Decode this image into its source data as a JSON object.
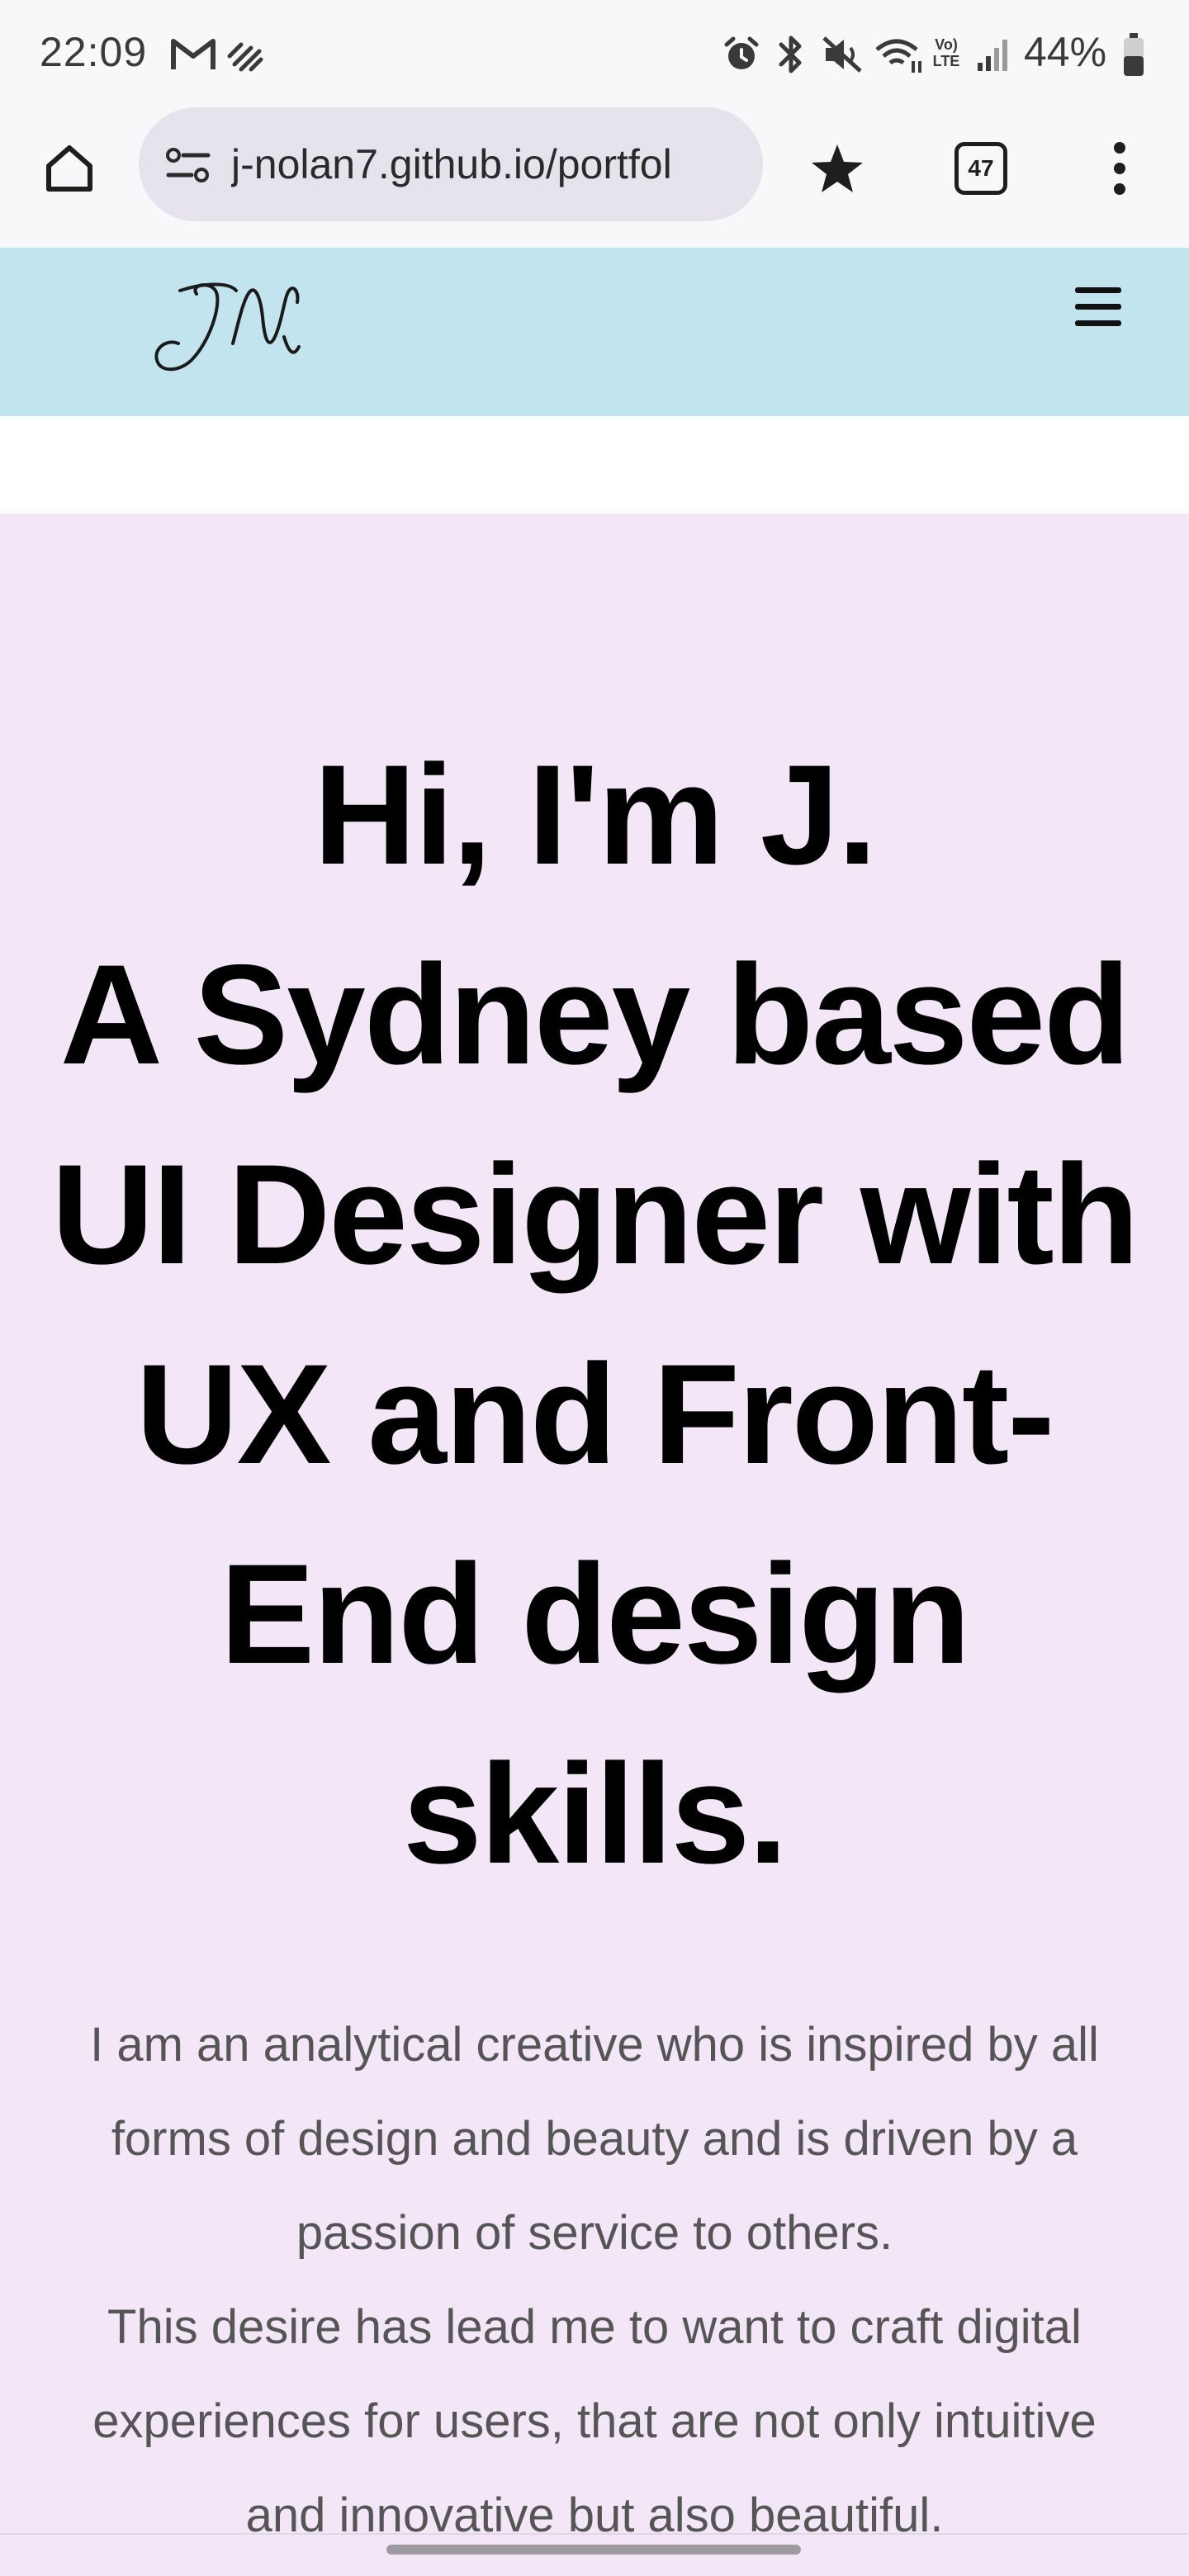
{
  "status_bar": {
    "time": "22:09",
    "battery": "44%",
    "icons": [
      "gmail-icon",
      "signal-activity-icon",
      "alarm-icon",
      "bluetooth-icon",
      "mute-icon",
      "wifi-icon",
      "volte-icon",
      "cell-signal-icon",
      "battery-icon"
    ],
    "volte_label": "Vo) LTE"
  },
  "browser": {
    "url": "j-nolan7.github.io/portfol",
    "tab_count": "47",
    "icons": [
      "home-icon",
      "site-settings-icon",
      "bookmark-star-icon",
      "tabs-icon",
      "more-vert-icon"
    ]
  },
  "site": {
    "logo_text": "JN",
    "header_color": "#c1e4ee",
    "hero_color": "#f3e7f7",
    "heading_lines": [
      "Hi, I'm J.",
      "A Sydney based",
      "UI Designer with",
      "UX and Front-",
      "End design",
      "skills."
    ],
    "intro_lines": [
      "I am an analytical creative who is inspired by all",
      "forms of design and beauty and is driven by a",
      "passion of service to others.",
      "This desire has lead me to want to craft digital",
      "experiences for users, that are not only intuitive",
      "and innovative but also beautiful."
    ]
  }
}
